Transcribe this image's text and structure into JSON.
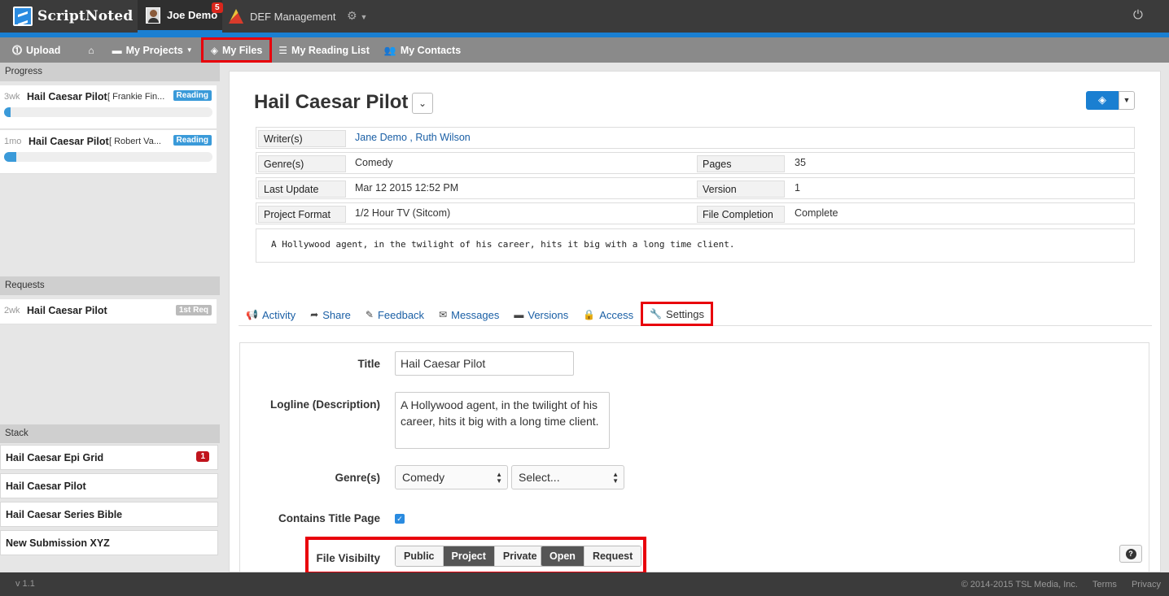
{
  "app": {
    "brand": "ScriptNoted",
    "version": "v 1.1"
  },
  "topbar": {
    "user_name": "Joe Demo",
    "notifications": "5",
    "org_name": "DEF Management"
  },
  "subnav": {
    "upload": "Upload",
    "my_projects": "My Projects",
    "my_files": "My Files",
    "my_reading_list": "My Reading List",
    "my_contacts": "My Contacts"
  },
  "sidebar": {
    "progress_head": "Progress",
    "progress": [
      {
        "age": "3wk",
        "title": "Hail Caesar Pilot",
        "reader": "[ Frankie Fin...",
        "status": "Reading",
        "progress": 0.03
      },
      {
        "age": "1mo",
        "title": "Hail Caesar Pilot",
        "reader": "[ Robert Va...",
        "status": "Reading",
        "progress": 0.06
      }
    ],
    "requests_head": "Requests",
    "requests": [
      {
        "age": "2wk",
        "title": "Hail Caesar Pilot",
        "status": "1st Req"
      }
    ],
    "stack_head": "Stack",
    "stack": [
      {
        "title": "Hail Caesar Epi Grid",
        "badge": "1"
      },
      {
        "title": "Hail Caesar Pilot"
      },
      {
        "title": "Hail Caesar Series Bible"
      },
      {
        "title": "New Submission XYZ"
      }
    ]
  },
  "project": {
    "title": "Hail Caesar Pilot",
    "writers_label": "Writer(s)",
    "writer1": "Jane Demo",
    "writer_sep": " , ",
    "writer2": "Ruth Wilson",
    "genre_label": "Genre(s)",
    "genre": "Comedy",
    "pages_label": "Pages",
    "pages": "35",
    "last_update_label": "Last Update",
    "last_update": "Mar 12 2015 12:52 PM",
    "version_label": "Version",
    "version": "1",
    "format_label": "Project Format",
    "format": "1/2 Hour TV (Sitcom)",
    "completion_label": "File Completion",
    "completion": "Complete",
    "logline": "A Hollywood agent, in the twilight of his career, hits it big with a long time client."
  },
  "tabs": {
    "activity": "Activity",
    "share": "Share",
    "feedback": "Feedback",
    "messages": "Messages",
    "versions": "Versions",
    "access": "Access",
    "settings": "Settings"
  },
  "settings": {
    "title_label": "Title",
    "title_value": "Hail Caesar Pilot",
    "logline_label": "Logline (Description)",
    "logline_value": "A Hollywood agent, in the twilight of his career, hits it big with a long time client.",
    "genre_label": "Genre(s)",
    "genre_value": "Comedy",
    "genre2_value": "Select...",
    "title_page_label": "Contains Title Page",
    "visibility_label": "File Visibilty",
    "visibility_options": [
      "Public",
      "Project",
      "Private"
    ],
    "access_options": [
      "Open",
      "Request"
    ]
  },
  "footer": {
    "copyright": "© 2014-2015 TSL Media, Inc.",
    "terms": "Terms",
    "privacy": "Privacy"
  }
}
